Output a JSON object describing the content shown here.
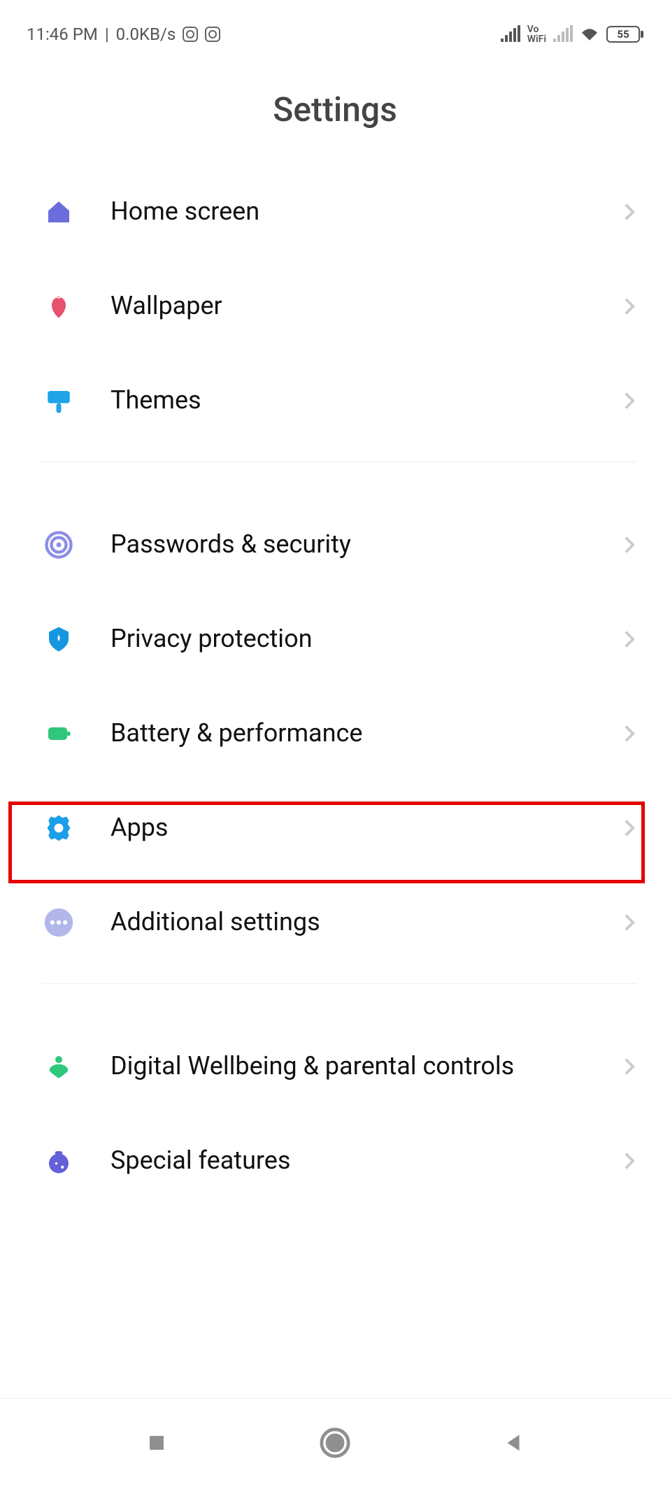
{
  "status_bar": {
    "time": "11:46 PM",
    "data_rate": "0.0KB/s",
    "battery_level": "55"
  },
  "page": {
    "title": "Settings"
  },
  "sections": [
    {
      "items": [
        {
          "id": "home-screen",
          "label": "Home screen"
        },
        {
          "id": "wallpaper",
          "label": "Wallpaper"
        },
        {
          "id": "themes",
          "label": "Themes"
        }
      ]
    },
    {
      "items": [
        {
          "id": "passwords-security",
          "label": "Passwords & security"
        },
        {
          "id": "privacy-protection",
          "label": "Privacy protection"
        },
        {
          "id": "battery-performance",
          "label": "Battery & performance"
        },
        {
          "id": "apps",
          "label": "Apps",
          "highlighted": true
        },
        {
          "id": "additional-settings",
          "label": "Additional settings"
        }
      ]
    },
    {
      "items": [
        {
          "id": "digital-wellbeing",
          "label": "Digital Wellbeing & parental controls"
        },
        {
          "id": "special-features",
          "label": "Special features"
        }
      ]
    }
  ]
}
